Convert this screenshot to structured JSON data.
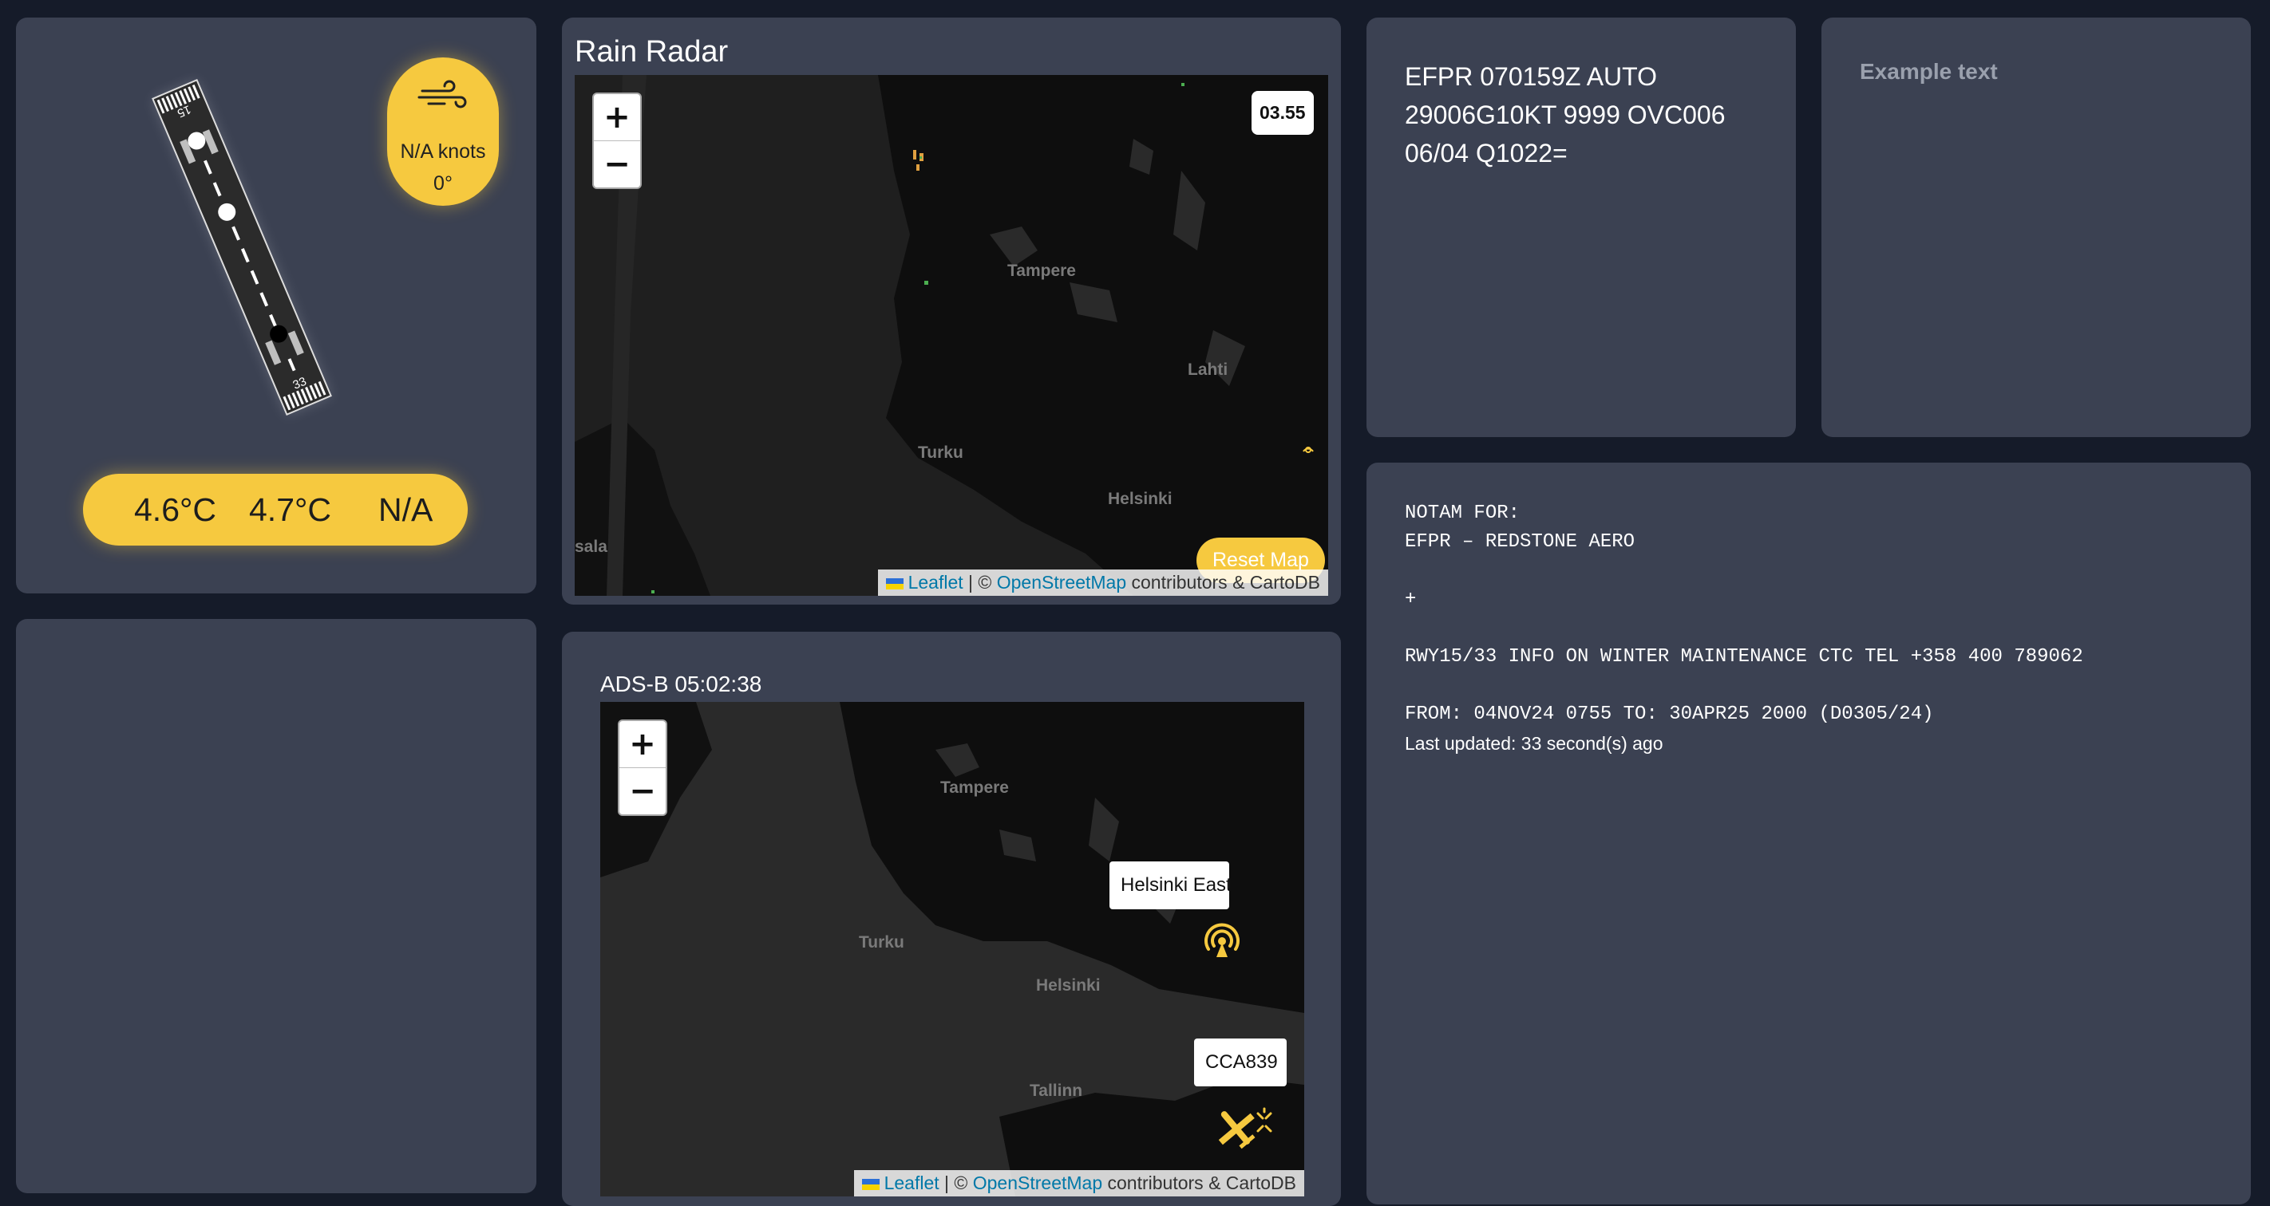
{
  "runway": {
    "end_top_label": "15",
    "end_bottom_label": "33",
    "wind_speed": "N/A knots",
    "wind_direction": "0°",
    "wind_icon": "wind-icon",
    "temperature": "4.6°C",
    "dewpoint": "4.7°C",
    "extra_value": "N/A"
  },
  "rain_radar": {
    "title": "Rain Radar",
    "zoom_in": "+",
    "zoom_out": "−",
    "time": "03.55",
    "reset_label": "Reset Map",
    "cities": [
      "Tampere",
      "Lahti",
      "Turku",
      "Helsinki",
      "sala"
    ],
    "attribution": {
      "leaflet": "Leaflet",
      "sep": " | © ",
      "osm": "OpenStreetMap",
      "rest": " contributors & CartoDB"
    }
  },
  "adsb": {
    "title": "ADS-B 05:02:38",
    "zoom_in": "+",
    "zoom_out": "−",
    "cities": [
      "Tampere",
      "Turku",
      "Helsinki",
      "Tallinn"
    ],
    "aerodrome_tooltip": "Helsinki East Aerodrome",
    "aircraft_tooltip": "CCA839",
    "aerodrome_icon": "radar-tower-icon",
    "aircraft_icon": "airplane-icon",
    "attribution": {
      "leaflet": "Leaflet",
      "sep": " | © ",
      "osm": "OpenStreetMap",
      "rest": " contributors & CartoDB"
    }
  },
  "metar": {
    "lines": [
      "EFPR 070159Z AUTO",
      "29006G10KT 9999 OVC006",
      "06/04 Q1022="
    ]
  },
  "example_card": {
    "text": "Example text"
  },
  "notam": {
    "header": "NOTAM FOR:",
    "aerodrome": "EFPR – REDSTONE AERO",
    "plus": "+",
    "message": "RWY15/33 INFO ON WINTER MAINTENANCE CTC TEL +358 400 789062",
    "validity": "FROM: 04NOV24 0755 TO: 30APR25 2000 (D0305/24)",
    "updated": "Last updated: 33 second(s) ago"
  },
  "colors": {
    "accent": "#f6c93f",
    "card": "#3b4152",
    "background": "#151b29",
    "map": "#1d1d1d"
  }
}
